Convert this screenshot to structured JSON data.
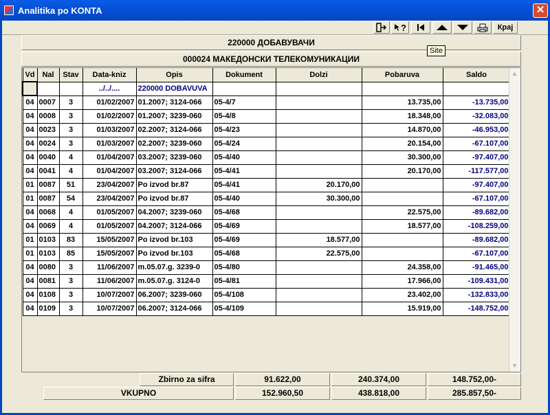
{
  "window": {
    "title": "Analitika po KONTA"
  },
  "toolbar": {
    "help_label": "?",
    "krai_label": "Крај"
  },
  "tooltip": "Site",
  "header": {
    "account": "220000 ДОБАВУВАЧИ",
    "partner": "000024  МАКЕДОНСКИ ТЕЛЕКОМУНИКАЦИИ"
  },
  "table": {
    "columns": [
      "Vd",
      "Nal",
      "Stav",
      "Data-kniz",
      "Opis",
      "Dokument",
      "Dolzi",
      "Pobaruva",
      "Saldo"
    ],
    "first_row": {
      "vd": "",
      "nal": "",
      "stav": "",
      "date": "../../....",
      "opis": "220000 DOBAVUVA",
      "dok": "",
      "dolzi": "",
      "pobaruva": "",
      "saldo": ""
    },
    "rows": [
      {
        "vd": "04",
        "nal": "0007",
        "stav": "3",
        "date": "01/02/2007",
        "opis": "01.2007; 3124-066",
        "dok": "05-4/7",
        "dolzi": "",
        "pobaruva": "13.735,00",
        "saldo": "-13.735,00"
      },
      {
        "vd": "04",
        "nal": "0008",
        "stav": "3",
        "date": "01/02/2007",
        "opis": "01.2007; 3239-060",
        "dok": "05-4/8",
        "dolzi": "",
        "pobaruva": "18.348,00",
        "saldo": "-32.083,00"
      },
      {
        "vd": "04",
        "nal": "0023",
        "stav": "3",
        "date": "01/03/2007",
        "opis": "02.2007; 3124-066",
        "dok": "05-4/23",
        "dolzi": "",
        "pobaruva": "14.870,00",
        "saldo": "-46.953,00"
      },
      {
        "vd": "04",
        "nal": "0024",
        "stav": "3",
        "date": "01/03/2007",
        "opis": "02.2007; 3239-060",
        "dok": "05-4/24",
        "dolzi": "",
        "pobaruva": "20.154,00",
        "saldo": "-67.107,00"
      },
      {
        "vd": "04",
        "nal": "0040",
        "stav": "4",
        "date": "01/04/2007",
        "opis": "03.2007; 3239-060",
        "dok": "05-4/40",
        "dolzi": "",
        "pobaruva": "30.300,00",
        "saldo": "-97.407,00"
      },
      {
        "vd": "04",
        "nal": "0041",
        "stav": "4",
        "date": "01/04/2007",
        "opis": "03.2007; 3124-066",
        "dok": "05-4/41",
        "dolzi": "",
        "pobaruva": "20.170,00",
        "saldo": "-117.577,00"
      },
      {
        "vd": "01",
        "nal": "0087",
        "stav": "51",
        "date": "23/04/2007",
        "opis": "Po izvod br.87",
        "dok": "05-4/41",
        "dolzi": "20.170,00",
        "pobaruva": "",
        "saldo": "-97.407,00"
      },
      {
        "vd": "01",
        "nal": "0087",
        "stav": "54",
        "date": "23/04/2007",
        "opis": "Po izvod br.87",
        "dok": "05-4/40",
        "dolzi": "30.300,00",
        "pobaruva": "",
        "saldo": "-67.107,00"
      },
      {
        "vd": "04",
        "nal": "0068",
        "stav": "4",
        "date": "01/05/2007",
        "opis": "04.2007; 3239-060",
        "dok": "05-4/68",
        "dolzi": "",
        "pobaruva": "22.575,00",
        "saldo": "-89.682,00"
      },
      {
        "vd": "04",
        "nal": "0069",
        "stav": "4",
        "date": "01/05/2007",
        "opis": "04.2007; 3124-066",
        "dok": "05-4/69",
        "dolzi": "",
        "pobaruva": "18.577,00",
        "saldo": "-108.259,00"
      },
      {
        "vd": "01",
        "nal": "0103",
        "stav": "83",
        "date": "15/05/2007",
        "opis": "Po izvod br.103",
        "dok": "05-4/69",
        "dolzi": "18.577,00",
        "pobaruva": "",
        "saldo": "-89.682,00"
      },
      {
        "vd": "01",
        "nal": "0103",
        "stav": "85",
        "date": "15/05/2007",
        "opis": "Po izvod br.103",
        "dok": "05-4/68",
        "dolzi": "22.575,00",
        "pobaruva": "",
        "saldo": "-67.107,00"
      },
      {
        "vd": "04",
        "nal": "0080",
        "stav": "3",
        "date": "11/06/2007",
        "opis": "m.05.07.g. 3239-0",
        "dok": "05-4/80",
        "dolzi": "",
        "pobaruva": "24.358,00",
        "saldo": "-91.465,00"
      },
      {
        "vd": "04",
        "nal": "0081",
        "stav": "3",
        "date": "11/06/2007",
        "opis": "m.05.07.g. 3124-0",
        "dok": "05-4/81",
        "dolzi": "",
        "pobaruva": "17.966,00",
        "saldo": "-109.431,00"
      },
      {
        "vd": "04",
        "nal": "0108",
        "stav": "3",
        "date": "10/07/2007",
        "opis": "06.2007; 3239-060",
        "dok": "05-4/108",
        "dolzi": "",
        "pobaruva": "23.402,00",
        "saldo": "-132.833,00"
      },
      {
        "vd": "04",
        "nal": "0109",
        "stav": "3",
        "date": "10/07/2007",
        "opis": "06.2007; 3124-066",
        "dok": "05-4/109",
        "dolzi": "",
        "pobaruva": "15.919,00",
        "saldo": "-148.752,00"
      }
    ]
  },
  "summary": {
    "sifra_label": "Zbirno za sifra",
    "sifra_dolzi": "91.622,00",
    "sifra_pobaruva": "240.374,00",
    "sifra_saldo": "148.752,00-",
    "vkupno_label": "VKUPNO",
    "vkupno_dolzi": "152.960,50",
    "vkupno_pobaruva": "438.818,00",
    "vkupno_saldo": "285.857,50-"
  },
  "colors": {
    "title_bar": "#0446c2",
    "saldo_text": "#000080"
  }
}
